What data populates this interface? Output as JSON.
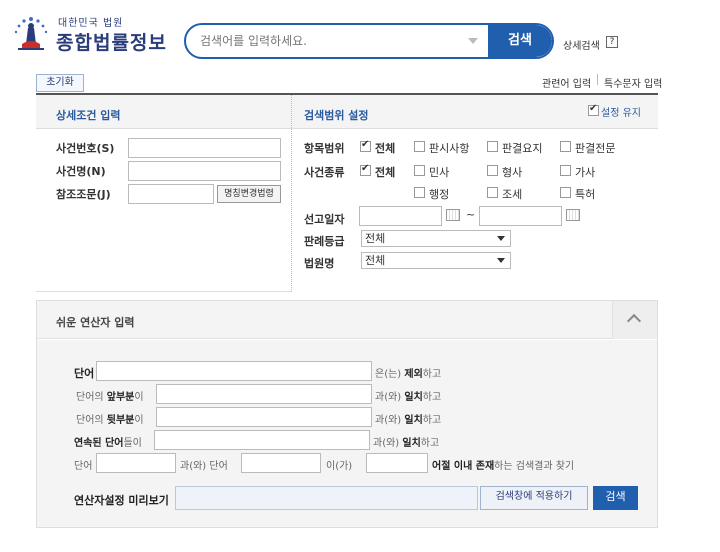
{
  "header": {
    "logo_small": "대한민국 법원",
    "logo_big": "종합법률정보",
    "search_placeholder": "검색어를 입력하세요.",
    "search_button": "검색",
    "advanced_search": "상세검색",
    "help": "?"
  },
  "toolbar": {
    "reset": "초기화",
    "related_terms": "관련어 입력",
    "special_chars": "특수문자 입력"
  },
  "detail": {
    "title": "상세조건 입력",
    "case_number_label": "사건번호(S)",
    "case_name_label": "사건명(N)",
    "ref_article_label": "참조조문(J)",
    "law_name_button": "명칭변경법령"
  },
  "scope": {
    "title": "검색범위 설정",
    "keep_setting": "설정 유지",
    "item_range_label": "항목범위",
    "item_options": [
      "전체",
      "판시사항",
      "판결요지",
      "판결전문"
    ],
    "case_type_label": "사건종류",
    "case_type_row1": [
      "전체",
      "민사",
      "형사",
      "가사"
    ],
    "case_type_row2": [
      "행정",
      "조세",
      "특허"
    ],
    "date_label": "선고일자",
    "date_sep": "~",
    "grade_label": "판례등급",
    "grade_value": "전체",
    "court_label": "법원명",
    "court_value": "전체"
  },
  "operator": {
    "title": "쉬운 연산자 입력",
    "row1": {
      "a": "단어",
      "b": "은(는) ",
      "c": "제외",
      "d": "하고"
    },
    "row2": {
      "a": "단어의 ",
      "b": "앞부분",
      "c": "이",
      "d": "과(와) ",
      "e": "일치",
      "f": "하고"
    },
    "row3": {
      "a": "단어의 ",
      "b": "뒷부분",
      "c": "이",
      "d": "과(와) ",
      "e": "일치",
      "f": "하고"
    },
    "row4": {
      "a": "연속된 단어",
      "b": "들이",
      "c": "과(와) ",
      "d": "일치",
      "e": "하고"
    },
    "row5": {
      "a": "단어",
      "b": "과(와) 단어",
      "c": "이(가)",
      "d": "어절 이내 존재",
      "e": "하는 검색결과 찾기"
    },
    "preview_label": "연산자설정 미리보기",
    "apply_button": "검색창에 적용하기",
    "search_button": "검색"
  }
}
